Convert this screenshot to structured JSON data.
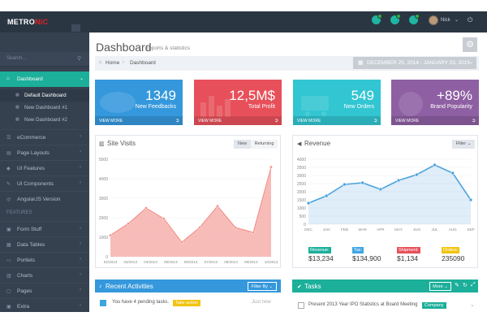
{
  "app": {
    "logo_main": "METRO",
    "logo_accent": "NIC"
  },
  "topbar": {
    "username": "Nick",
    "caret": "⌄",
    "logout": "⏻"
  },
  "sidebar": {
    "search_placeholder": "Search...",
    "items": [
      {
        "label": "Dashboard",
        "icon": "⌂",
        "arrow": "⌄"
      },
      {
        "label": "eCommerce",
        "icon": "☰",
        "arrow": "›"
      },
      {
        "label": "Page Layouts",
        "icon": "▤",
        "arrow": "›"
      },
      {
        "label": "UI Features",
        "icon": "◆",
        "arrow": "›"
      },
      {
        "label": "UI Components",
        "icon": "✎",
        "arrow": "›"
      },
      {
        "label": "AngularJS Version",
        "icon": "◎",
        "arrow": ""
      }
    ],
    "subitems": [
      {
        "label": "Default Dashboard",
        "icon": "▦"
      },
      {
        "label": "New Dashboard #1",
        "icon": "▦"
      },
      {
        "label": "New Dashboard #2",
        "icon": "▦"
      }
    ],
    "section_heading": "FEATURES",
    "feature_items": [
      {
        "label": "Form Stuff",
        "icon": "▣",
        "arrow": "›"
      },
      {
        "label": "Data Tables",
        "icon": "▦",
        "arrow": "›"
      },
      {
        "label": "Portlets",
        "icon": "▭",
        "arrow": "›"
      },
      {
        "label": "Charts",
        "icon": "▥",
        "arrow": "›"
      },
      {
        "label": "Pages",
        "icon": "▢",
        "arrow": "›"
      },
      {
        "label": "Extra",
        "icon": "▣",
        "arrow": "›"
      }
    ]
  },
  "page": {
    "title": "Dashboard",
    "subtitle": "reports & statistics",
    "breadcrumb": {
      "home": "Home",
      "separator": "›",
      "current": "Dashboard"
    },
    "daterange": "DECEMBER 25, 2014 - JANUARY 23, 2015"
  },
  "tiles": [
    {
      "number": "1349",
      "label": "New Feedbacks",
      "footer": "VIEW MORE",
      "color": "#3598dc"
    },
    {
      "number": "12,5M$",
      "label": "Total Profit",
      "footer": "VIEW MORE",
      "color": "#e7505a"
    },
    {
      "number": "549",
      "label": "New Orders",
      "footer": "VIEW MORE",
      "color": "#32c5d2"
    },
    {
      "number": "+89%",
      "label": "Brand Popularity",
      "footer": "VIEW MORE",
      "color": "#8e5fa2"
    }
  ],
  "site_visits": {
    "title": "Site Visits",
    "btn_new": "New",
    "btn_returning": "Returning"
  },
  "revenue": {
    "title": "Revenue",
    "filter": "Filter",
    "stats": [
      {
        "label": "Revenue:",
        "value": "$13,234",
        "color": "#1caf9a"
      },
      {
        "label": "Tax:",
        "value": "$134,900",
        "color": "#3fa5e0"
      },
      {
        "label": "Shipment:",
        "value": "$1,134",
        "color": "#e7505a"
      },
      {
        "label": "Orders:",
        "value": "235090",
        "color": "#f1c40f"
      }
    ]
  },
  "recent_activities": {
    "title": "Recent Activities",
    "filter": "Filter By",
    "row_text": "You have 4 pending tasks.",
    "row_tag": "Take action",
    "row_time": "Just now"
  },
  "tasks": {
    "title": "Tasks",
    "more": "More",
    "row_text": "Present 2013 Year IPO Statistics at Board Meeting",
    "row_tag": "Company"
  },
  "chart_data": [
    {
      "type": "area",
      "title": "Site Visits",
      "x": [
        "02/2013",
        "03/2013",
        "04/2013",
        "05/2013",
        "06/2013",
        "07/2013",
        "08/2013",
        "09/2013",
        "10/2013"
      ],
      "series": [
        {
          "values": [
            1100,
            1700,
            2500,
            1950,
            750,
            1500,
            2600,
            1500,
            1250,
            4600
          ]
        }
      ],
      "yticks": [
        0,
        1000,
        2000,
        3000,
        4000,
        5000
      ],
      "ylim": [
        0,
        5000
      ],
      "color": "#f4a6a0"
    },
    {
      "type": "area",
      "title": "Revenue",
      "x": [
        "DEC",
        "JAN",
        "FEB",
        "MAR",
        "APR",
        "MAY",
        "JUN",
        "JUL",
        "AUG",
        "SEP"
      ],
      "series": [
        {
          "values": [
            1300,
            1750,
            2450,
            2550,
            2150,
            2700,
            3050,
            3650,
            3150,
            1500
          ]
        }
      ],
      "yticks": [
        0,
        500,
        1000,
        1500,
        2000,
        2500,
        3000,
        3500,
        4000
      ],
      "ylim": [
        0,
        4000
      ],
      "color": "#4fa3dd"
    }
  ]
}
